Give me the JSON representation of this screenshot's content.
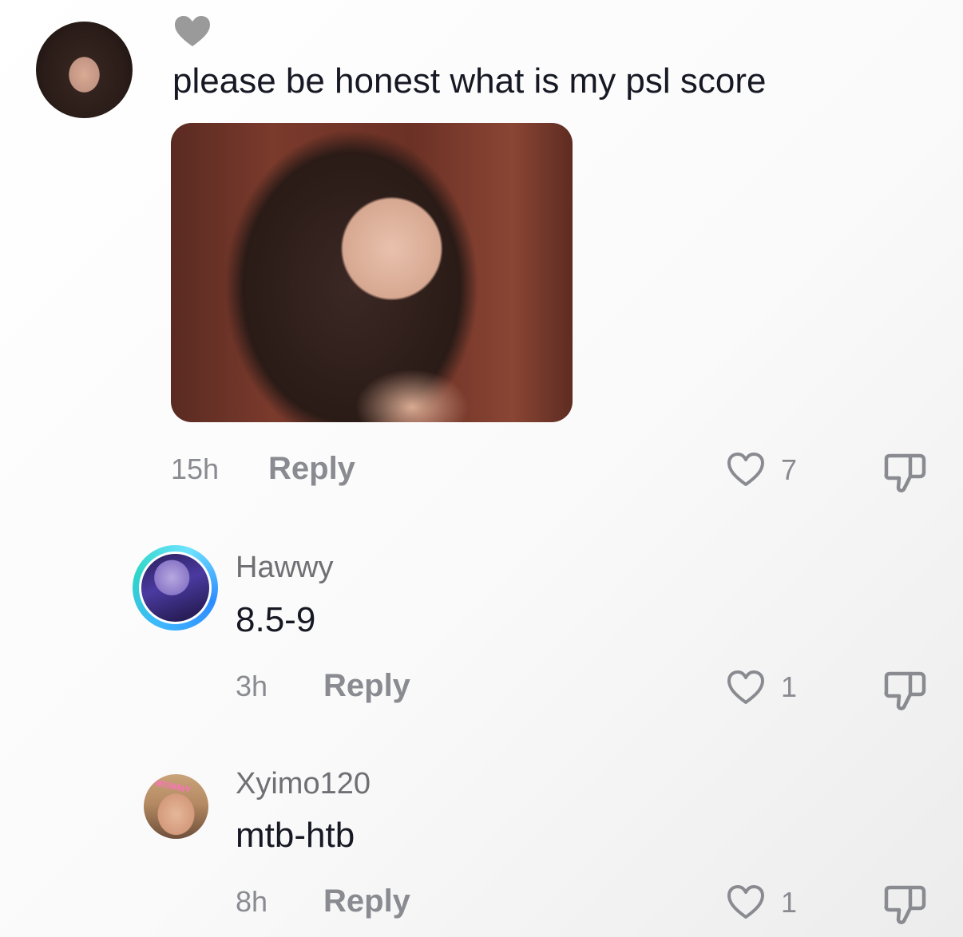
{
  "main_comment": {
    "text": "please be honest what is my psl score",
    "time": "15h",
    "reply_label": "Reply",
    "likes": "7"
  },
  "replies": [
    {
      "username": "Hawwy",
      "text": "8.5-9",
      "time": "3h",
      "reply_label": "Reply",
      "likes": "1"
    },
    {
      "username": "Xyimo120",
      "text": "mtb-htb",
      "time": "8h",
      "reply_label": "Reply",
      "likes": "1",
      "avatar_tag": "MOMMY"
    }
  ],
  "icons": {
    "like": "heart-outline-icon",
    "dislike": "thumbs-down-outline-icon",
    "liked_by_creator": "heart-badge-icon"
  },
  "colors": {
    "text_primary": "#161823",
    "text_secondary": "#8a8b91",
    "username": "#6f6f74"
  }
}
